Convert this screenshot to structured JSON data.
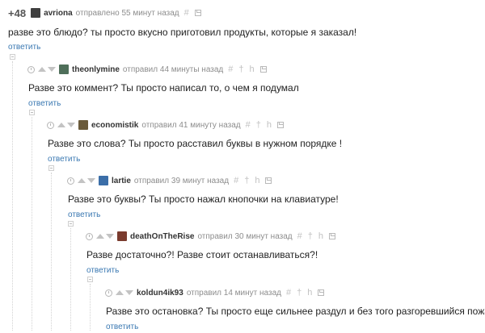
{
  "comments": [
    {
      "rating": "+48",
      "user": "avriona",
      "meta": "отправлено 55 минут назад",
      "text": "разве это блюдо? ты просто вкусно приготовил продукты, которые я заказал!",
      "reply": "ответить",
      "avatar_color": "#3f3f3f"
    },
    {
      "user": "theonlymine",
      "meta": "отправил 44 минуты назад",
      "text": "Разве это коммент? Ты просто написал то, о чем я подумал",
      "reply": "ответить",
      "avatar_color": "#4f6f5a"
    },
    {
      "user": "economistik",
      "meta": "отправил 41 минуту назад",
      "text": "Разве это слова? Ты просто расставил буквы в нужном порядке !",
      "reply": "ответить",
      "avatar_color": "#6a5a3a"
    },
    {
      "user": "lartie",
      "meta": "отправил 39 минут назад",
      "text": "Разве это буквы? Ты просто нажал кнопочки на клавиатуре!",
      "reply": "ответить",
      "avatar_color": "#3b6ea8"
    },
    {
      "user": "deathOnTheRise",
      "meta": "отправил 30 минут назад",
      "text": "Разве достаточно?! Разве стоит останавливаться?!",
      "reply": "ответить",
      "avatar_color": "#7a3b2e"
    },
    {
      "user": "koldun4ik93",
      "meta": "отправил 14 минут назад",
      "text": "Разве это остановка? Ты просто еще сильнее раздул и без того разгоревшийся пожар",
      "reply": "ответить"
    }
  ],
  "icons": {
    "hash": "#",
    "pin": "†",
    "branch": "h"
  },
  "colors": {
    "link": "#3a78b2",
    "meta": "#8d8d8d",
    "icon": "#c2c2c2"
  }
}
